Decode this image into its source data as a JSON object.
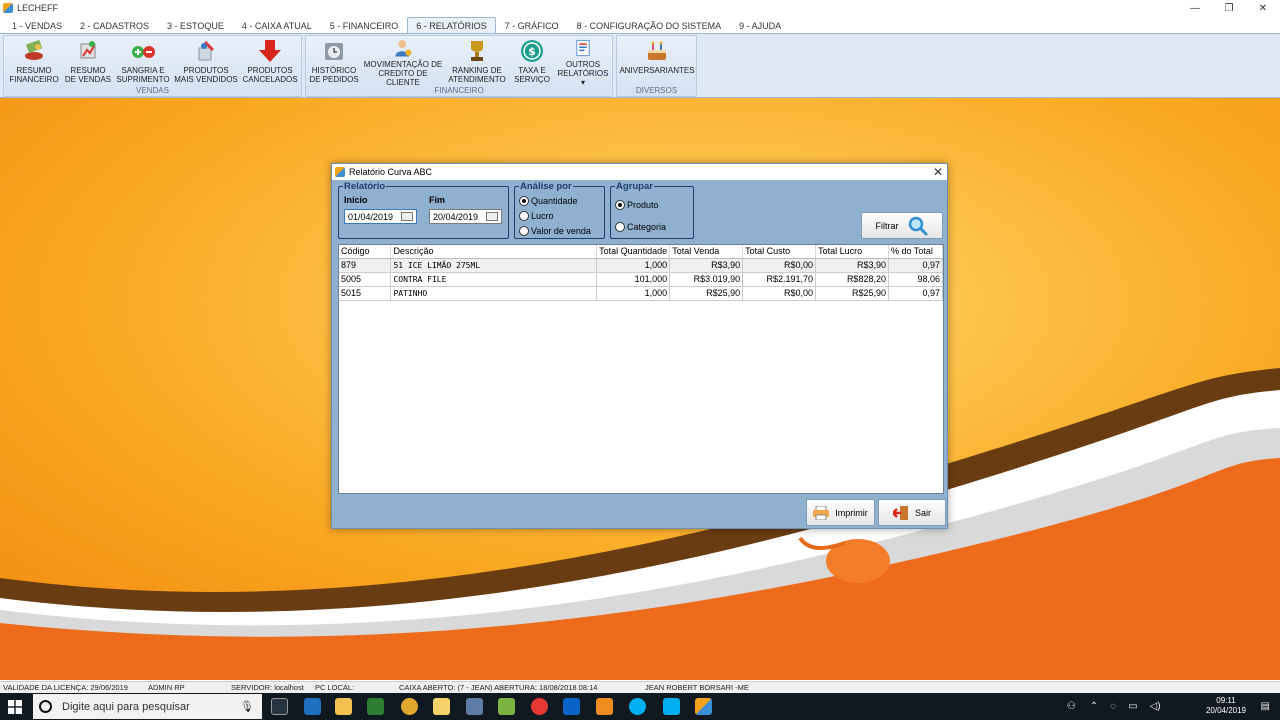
{
  "window": {
    "title": "LECHEFF",
    "min": "—",
    "restore": "❐",
    "close": "✕"
  },
  "menu": {
    "tabs": [
      {
        "label": "1 - VENDAS"
      },
      {
        "label": "2 - CADASTROS"
      },
      {
        "label": "3 - ESTOQUE"
      },
      {
        "label": "4 - CAIXA ATUAL"
      },
      {
        "label": "5 - FINANCEIRO"
      },
      {
        "label": "6 - RELATÓRIOS"
      },
      {
        "label": "7 - GRÁFICO"
      },
      {
        "label": "8 - CONFIGURAÇÃO DO SISTEMA"
      },
      {
        "label": "9 - AJUDA"
      }
    ],
    "active": "6 - RELATÓRIOS"
  },
  "ribbon": {
    "groups": {
      "vendas": "VENDAS",
      "financeiro": "FINANCEIRO",
      "diversos": "DIVERSOS"
    },
    "buttons": {
      "resumo_financeiro": "RESUMO\nFINANCEIRO",
      "resumo_vendas": "RESUMO\nDE VENDAS",
      "sangria": "SANGRIA E\nSUPRIMENTO",
      "mais_vendidos": "PRODUTOS\nMAIS VENDIDOS",
      "cancelados": "PRODUTOS\nCANCELADOS",
      "historico": "HISTÓRICO\nDE PEDIDOS",
      "movimentacao": "MOVIMENTAÇÃO DE\nCREDITO DE CLIENTE",
      "ranking": "RANKING DE\nATENDIMENTO",
      "taxa": "TAXA E\nSERVIÇO",
      "outros": "OUTROS\nRELATÓRIOS ▾",
      "aniversariantes": "ANIVERSARIANTES"
    }
  },
  "dialog": {
    "title": "Relatório Curva ABC",
    "relatorio": {
      "legend": "Relatório",
      "inicio_label": "Início",
      "fim_label": "Fim",
      "inicio": "01/04/2019",
      "fim": "20/04/2019"
    },
    "analise": {
      "legend": "Análise por",
      "options": [
        "Quantidade",
        "Lucro",
        "Valor de venda"
      ],
      "selected": "Quantidade"
    },
    "agrupar": {
      "legend": "Agrupar",
      "options": [
        "Produto",
        "Categoria"
      ],
      "selected": "Produto"
    },
    "filtrar": "Filtrar",
    "imprimir": "Imprimir",
    "sair": "Sair",
    "table": {
      "columns": [
        "Código",
        "Descrição",
        "Total Quantidade",
        "Total Venda",
        "Total Custo",
        "Total Lucro",
        "% do Total"
      ],
      "rows": [
        [
          "879",
          "51 ICE LIMÃO 275ML",
          "1,000",
          "R$3,90",
          "R$0,00",
          "R$3,90",
          "0,97"
        ],
        [
          "5005",
          "CONTRA FILE",
          "101,000",
          "R$3.019,90",
          "R$2.191,70",
          "R$828,20",
          "98,06"
        ],
        [
          "5015",
          "PATINHO",
          "1,000",
          "R$25,90",
          "R$0,00",
          "R$25,90",
          "0,97"
        ]
      ]
    }
  },
  "status": {
    "validade": "VALIDADE DA LICENÇA: 29/06/2019",
    "admin": "ADMIN RP",
    "servidor": "SERVIDOR: localhost",
    "pc": "PC LOCAL:",
    "caixa": "CAIXA ABERTO: (7 - JEAN) ABERTURA: 18/08/2018 08:14",
    "usuario": "JEAN ROBERT BORSARI -ME"
  },
  "taskbar": {
    "search_placeholder": "Digite aqui para pesquisar",
    "time": "09:11",
    "date": "20/04/2019"
  },
  "colors": {
    "accent": "#f5a019",
    "ribbon": "#dfe9f5",
    "dialog_bg": "#8fb1cf"
  }
}
